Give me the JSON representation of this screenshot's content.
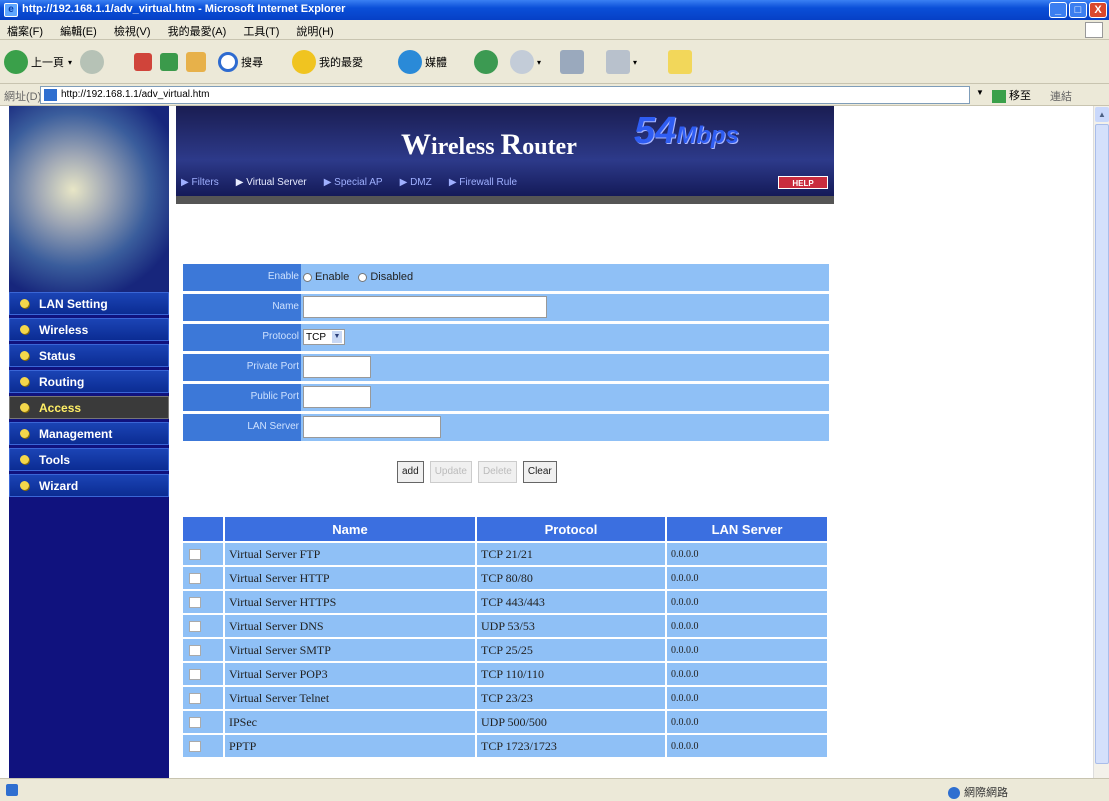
{
  "window": {
    "title": "http://192.168.1.1/adv_virtual.htm - Microsoft Internet Explorer",
    "controls": [
      "_",
      "□",
      "X"
    ]
  },
  "menubar": [
    "檔案(F)",
    "編輯(E)",
    "檢視(V)",
    "我的最愛(A)",
    "工具(T)",
    "說明(H)"
  ],
  "toolbar": {
    "back": "上一頁",
    "search": "搜尋",
    "favorites": "我的最愛",
    "media": "媒體"
  },
  "addressbar": {
    "label": "網址(D)",
    "url": "http://192.168.1.1/adv_virtual.htm",
    "go": "移至",
    "links": "連結"
  },
  "banner": {
    "product_w": "W",
    "product_rest1": "ireless ",
    "product_r": "R",
    "product_rest2": "outer",
    "speed": "54",
    "speed_unit": "Mbps",
    "tabs": [
      {
        "label": "▶ Filters"
      },
      {
        "label": "▶ Virtual Server"
      },
      {
        "label": "▶ Special AP"
      },
      {
        "label": "▶ DMZ"
      },
      {
        "label": "▶ Firewall Rule"
      }
    ],
    "help": "HELP"
  },
  "sidebar": {
    "items": [
      {
        "label": "LAN Setting"
      },
      {
        "label": "Wireless"
      },
      {
        "label": "Status"
      },
      {
        "label": "Routing"
      },
      {
        "label": "Access"
      },
      {
        "label": "Management"
      },
      {
        "label": "Tools"
      },
      {
        "label": "Wizard"
      }
    ],
    "active_index": 4
  },
  "form": {
    "enable_label": "Enable",
    "enable_option": "Enable",
    "disable_option": "Disabled",
    "name_label": "Name",
    "name_value": "",
    "protocol_label": "Protocol",
    "protocol_value": "TCP",
    "private_port_label": "Private Port",
    "private_port_value": "",
    "public_port_label": "Public Port",
    "public_port_value": "",
    "lan_server_label": "LAN Server",
    "lan_server_value": ""
  },
  "buttons": {
    "add": "add",
    "update": "Update",
    "delete": "Delete",
    "clear": "Clear"
  },
  "table": {
    "headers": [
      "Name",
      "Protocol",
      "LAN Server"
    ],
    "rows": [
      {
        "name": "Virtual Server FTP",
        "protocol": "TCP 21/21",
        "lan": "0.0.0.0"
      },
      {
        "name": "Virtual Server HTTP",
        "protocol": "TCP 80/80",
        "lan": "0.0.0.0"
      },
      {
        "name": "Virtual Server HTTPS",
        "protocol": "TCP 443/443",
        "lan": "0.0.0.0"
      },
      {
        "name": "Virtual Server DNS",
        "protocol": "UDP 53/53",
        "lan": "0.0.0.0"
      },
      {
        "name": "Virtual Server SMTP",
        "protocol": "TCP 25/25",
        "lan": "0.0.0.0"
      },
      {
        "name": "Virtual Server POP3",
        "protocol": "TCP 110/110",
        "lan": "0.0.0.0"
      },
      {
        "name": "Virtual Server Telnet",
        "protocol": "TCP 23/23",
        "lan": "0.0.0.0"
      },
      {
        "name": "IPSec",
        "protocol": "UDP 500/500",
        "lan": "0.0.0.0"
      },
      {
        "name": "PPTP",
        "protocol": "TCP 1723/1723",
        "lan": "0.0.0.0"
      }
    ]
  },
  "statusbar": {
    "zone": "網際網路"
  },
  "colors": {
    "sidebar_bg": "#10127e",
    "form_row": "#8fc0f6",
    "form_label": "#3c78d8",
    "table_header": "#3b6fe0",
    "help": "#c92c3e",
    "speed": "#2f5df2"
  }
}
